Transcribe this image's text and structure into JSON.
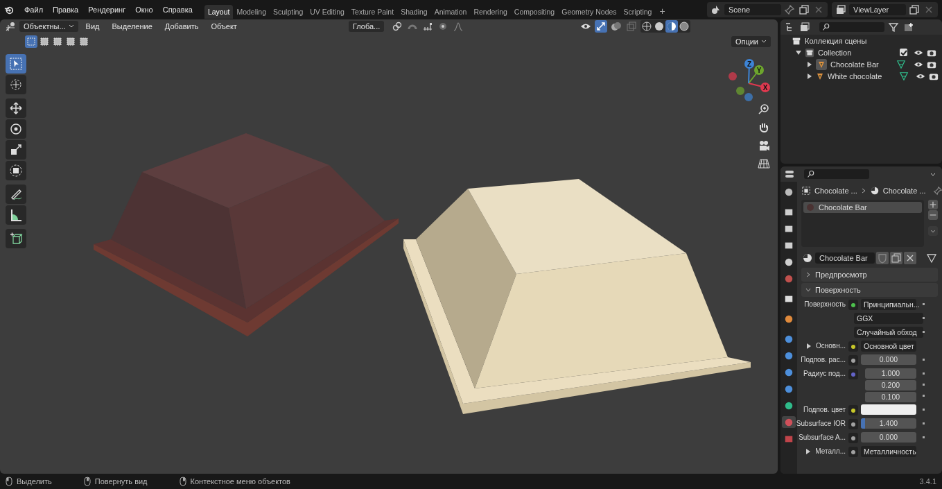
{
  "menu": [
    "Файл",
    "Правка",
    "Рендеринг",
    "Окно",
    "Справка"
  ],
  "workspaces": [
    {
      "label": "Layout",
      "selected": true
    },
    {
      "label": "Modeling",
      "selected": false
    },
    {
      "label": "Sculpting",
      "selected": false
    },
    {
      "label": "UV Editing",
      "selected": false
    },
    {
      "label": "Texture Paint",
      "selected": false
    },
    {
      "label": "Shading",
      "selected": false
    },
    {
      "label": "Animation",
      "selected": false
    },
    {
      "label": "Rendering",
      "selected": false
    },
    {
      "label": "Compositing",
      "selected": false
    },
    {
      "label": "Geometry Nodes",
      "selected": false
    },
    {
      "label": "Scripting",
      "selected": false
    }
  ],
  "add_workspace": "+",
  "scene": "Scene",
  "view_layer": "ViewLayer",
  "viewport": {
    "mode": "Объектны...",
    "menus": [
      "Вид",
      "Выделение",
      "Добавить",
      "Объект"
    ],
    "orientation": "Глоба...",
    "options": "Опции",
    "select_modes": [
      {
        "selected": true
      },
      {
        "selected": false
      },
      {
        "selected": false
      },
      {
        "selected": false
      },
      {
        "selected": false
      }
    ],
    "tool_groups": [
      [
        {
          "kind": "select",
          "selected": true
        },
        {
          "kind": "cursor",
          "selected": false
        }
      ],
      [
        {
          "kind": "move",
          "selected": false
        },
        {
          "kind": "rotate",
          "selected": false
        },
        {
          "kind": "scale",
          "selected": false
        },
        {
          "kind": "transform",
          "selected": false
        }
      ],
      [
        {
          "kind": "annotate",
          "selected": false
        },
        {
          "kind": "measure",
          "selected": false
        }
      ],
      [
        {
          "kind": "add_cube",
          "selected": false
        }
      ]
    ],
    "axes": [
      {
        "label": "X",
        "color": "#e0394f"
      },
      {
        "label": "Y",
        "color": "#6da52d"
      },
      {
        "label": "Z",
        "color": "#3d84d6"
      }
    ],
    "objects": [
      {
        "kind": "picture"
      },
      {
        "kind": "picture"
      }
    ]
  },
  "outliner": {
    "root": "Коллекция сцены",
    "collection": {
      "name": "Collection",
      "expanded": true,
      "checked": true,
      "children": [
        {
          "name": "Chocolate Bar",
          "active": true
        },
        {
          "name": "White chocolate",
          "active": false
        }
      ]
    }
  },
  "properties": {
    "tabs": [
      {
        "kind": "tool",
        "selected": false
      },
      {
        "kind": "render",
        "selected": false
      },
      {
        "kind": "output",
        "selected": false
      },
      {
        "kind": "view_layer",
        "selected": false
      },
      {
        "kind": "scene",
        "selected": false
      },
      {
        "kind": "world",
        "selected": false
      },
      {
        "kind": "collection",
        "selected": false
      },
      {
        "kind": "object",
        "selected": false
      },
      {
        "kind": "modifiers",
        "selected": false
      },
      {
        "kind": "particles",
        "selected": false
      },
      {
        "kind": "physics",
        "selected": false
      },
      {
        "kind": "constraints",
        "selected": false
      },
      {
        "kind": "data",
        "selected": false
      },
      {
        "kind": "material",
        "selected": true
      },
      {
        "kind": "texture",
        "selected": false
      }
    ],
    "breadcrumb": [
      "Chocolate ...",
      "Chocolate ..."
    ],
    "slots": [
      {
        "name": "Chocolate Bar",
        "selected": true
      }
    ],
    "material": "Chocolate Bar",
    "panels": [
      {
        "label": "Предпросмотр",
        "expanded": false
      },
      {
        "label": "Поверхность",
        "expanded": true
      }
    ],
    "rows": [
      {
        "kind": "socket",
        "label": "Поверхность",
        "color": "#4cc04c",
        "value": "Принципиальн..."
      },
      {
        "kind": "dropdown",
        "value": "GGX"
      },
      {
        "kind": "dropdown",
        "value": "Случайный обход"
      },
      {
        "kind": "socket",
        "label": "Основн...",
        "color": "#c7c729",
        "value": "Основной цвет",
        "expandable": true
      },
      {
        "kind": "number",
        "label": "Подпов. рас...",
        "color": "#a1a1a1",
        "value": "0.000"
      },
      {
        "kind": "vector",
        "label": "Радиус под...",
        "color": "#6363c7",
        "values": [
          "1.000",
          "0.200",
          "0.100"
        ]
      },
      {
        "kind": "swatch",
        "label": "Подпов. цвет",
        "color": "#c7c729"
      },
      {
        "kind": "slider",
        "label": "Subsurface IOR",
        "color": "#a1a1a1",
        "value": "1.400",
        "level": 0.07
      },
      {
        "kind": "number",
        "label": "Subsurface A...",
        "color": "#a1a1a1",
        "value": "0.000"
      },
      {
        "kind": "socket",
        "label": "Металл...",
        "color": "#a1a1a1",
        "value": "Металличность",
        "expandable": true
      }
    ]
  },
  "status": [
    "Выделить",
    "Повернуть вид",
    "Контекстное меню объектов"
  ],
  "version": "3.4.1"
}
